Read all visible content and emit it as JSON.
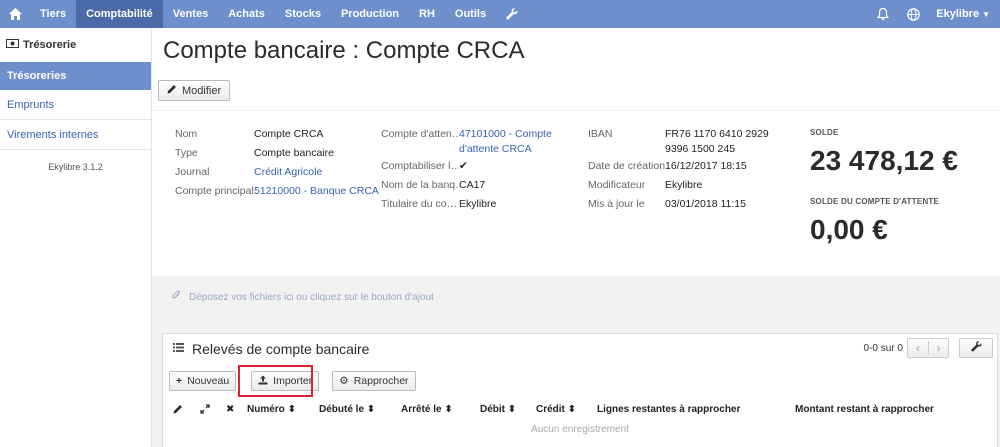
{
  "topbar": {
    "nav": [
      "Tiers",
      "Comptabilité",
      "Ventes",
      "Achats",
      "Stocks",
      "Production",
      "RH",
      "Outils"
    ],
    "active_index": 1,
    "user": "Ekylibre"
  },
  "sidebar": {
    "section_title": "Trésorerie",
    "items": [
      {
        "label": "Trésoreries",
        "active": true
      },
      {
        "label": "Emprunts",
        "active": false
      },
      {
        "label": "Virements internes",
        "active": false
      }
    ],
    "version": "Ekylibre 3.1.2"
  },
  "page": {
    "title": "Compte bancaire : Compte CRCA",
    "modifier_label": "Modifier"
  },
  "details": {
    "col1": [
      {
        "label": "Nom",
        "value": "Compte CRCA",
        "link": false
      },
      {
        "label": "Type",
        "value": "Compte bancaire",
        "link": false
      },
      {
        "label": "Journal",
        "value": "Crédit Agricole",
        "link": true
      },
      {
        "label": "Compte principal",
        "value": "51210000 - Banque CRCA",
        "link": true
      }
    ],
    "col2": [
      {
        "label": "Compte d'atten…",
        "value_line1": "47101000 - Compte",
        "value_line2": "d'attente CRCA",
        "link": true
      },
      {
        "label": "Comptabiliser l…",
        "value": "✔",
        "link": false
      },
      {
        "label": "Nom de la banq…",
        "value": "CA17",
        "link": false
      },
      {
        "label": "Titulaire du co…",
        "value": "Ekylibre",
        "link": false
      }
    ],
    "col3": [
      {
        "label": "IBAN",
        "value_line1": "FR76 1170 6410 2929",
        "value_line2": "9396 1500 245"
      },
      {
        "label": "Date de création",
        "value": "16/12/2017 18:15"
      },
      {
        "label": "Modificateur",
        "value": "Ekylibre"
      },
      {
        "label": "Mis à jour le",
        "value": "03/01/2018 11:15"
      }
    ],
    "solde_label": "SOLDE",
    "solde_value": "23 478,12 €",
    "solde_attente_label": "SOLDE DU COMPTE D'ATTENTE",
    "solde_attente_value": "0,00 €"
  },
  "dropzone": "Déposez vos fichiers ici ou cliquez sur le bouton d'ajout",
  "releves": {
    "title": "Relevés de compte bancaire",
    "pager_text": "0-0 sur 0",
    "buttons": {
      "nouveau": "Nouveau",
      "importer": "Importer",
      "rapprocher": "Rapprocher"
    },
    "columns": [
      "Numéro",
      "Débuté le",
      "Arrêté le",
      "Débit",
      "Crédit",
      "Lignes restantes à rapprocher",
      "Montant restant à rapprocher"
    ],
    "empty_text": "Aucun enregistrement"
  },
  "colors": {
    "accent": "#6d8fcc",
    "accent_dark": "#4a6aa8",
    "link": "#3a62b0",
    "highlight": "#e0232e"
  }
}
